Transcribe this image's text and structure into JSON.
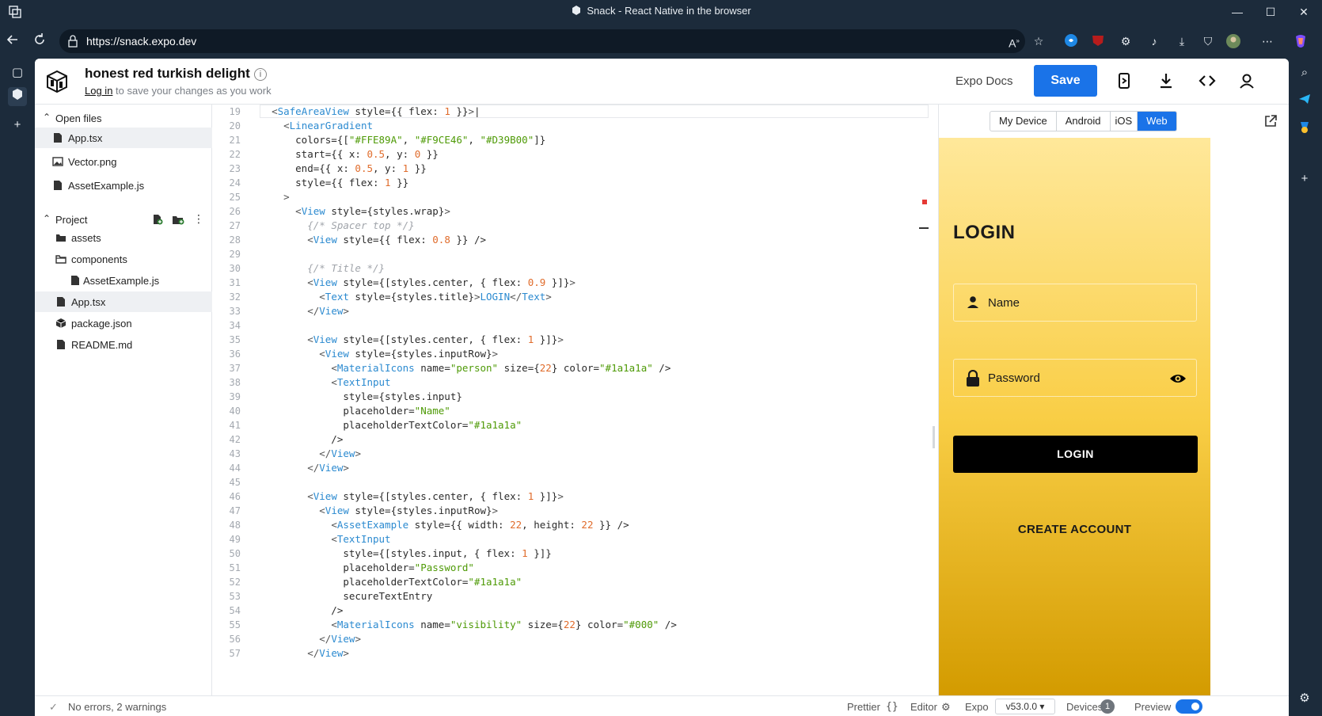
{
  "window": {
    "title": "Snack - React Native in the browser",
    "minimize": "—",
    "maximize": "☐",
    "close": "✕"
  },
  "browser": {
    "url": "https://snack.expo.dev",
    "icons": [
      "collections-icon",
      "back-icon",
      "refresh-icon",
      "read-aloud-icon",
      "favorite-icon",
      "extension-icons",
      "downloads-icon",
      "profile-icon",
      "more-icon",
      "copilot-icon"
    ]
  },
  "colors": {
    "accent": "#1a73e8",
    "gradient": [
      "#FFE89A",
      "#F9CE46",
      "#D39B00"
    ],
    "error": "#e53935"
  },
  "header": {
    "project_name": "honest red turkish delight",
    "login_link": "Log in",
    "login_suffix": " to save your changes as you work",
    "docs_link": "Expo Docs",
    "save_label": "Save"
  },
  "sidebar": {
    "open_files_label": "Open files",
    "open_files": [
      "App.tsx",
      "Vector.png",
      "AssetExample.js"
    ],
    "project_label": "Project",
    "project_items": [
      {
        "name": "assets",
        "type": "folder"
      },
      {
        "name": "components",
        "type": "folder-open"
      },
      {
        "name": "AssetExample.js",
        "type": "file"
      },
      {
        "name": "App.tsx",
        "type": "file"
      },
      {
        "name": "package.json",
        "type": "package"
      },
      {
        "name": "README.md",
        "type": "file"
      }
    ]
  },
  "editor": {
    "line_numbers": [
      "19",
      "20",
      "21",
      "22",
      "23",
      "24",
      "25",
      "26",
      "27",
      "28",
      "29",
      "30",
      "31",
      "32",
      "33",
      "34",
      "35",
      "36",
      "37",
      "38",
      "39",
      "40",
      "41",
      "42",
      "43",
      "44",
      "45",
      "46",
      "47",
      "48",
      "49",
      "50",
      "51",
      "52",
      "53",
      "54",
      "55",
      "56",
      "57"
    ]
  },
  "preview": {
    "tabs": [
      "My Device",
      "Android",
      "iOS",
      "Web"
    ],
    "active_tab": "Web",
    "screen": {
      "title": "LOGIN",
      "name_placeholder": "Name",
      "password_placeholder": "Password",
      "login_button": "LOGIN",
      "create_account": "CREATE ACCOUNT"
    }
  },
  "status": {
    "errors": "No errors, 2 warnings",
    "prettier": "Prettier",
    "prettier_icon": "{}",
    "editor": "Editor",
    "expo": "Expo",
    "expo_version": "v53.0.0 ▾",
    "devices": "Devices",
    "device_count": "1",
    "preview": "Preview"
  }
}
